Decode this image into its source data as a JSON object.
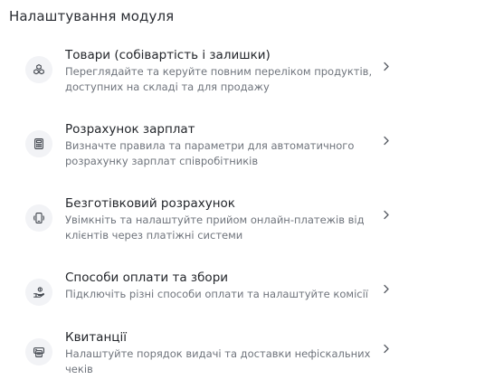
{
  "page": {
    "title": "Налаштування модуля"
  },
  "items": [
    {
      "title": "Товари (собівартість і залишки)",
      "description": "Переглядайте та керуйте повним переліком продуктів, доступних на складі та для продажу",
      "icon": "products-icon"
    },
    {
      "title": "Розрахунок зарплат",
      "description": "Визначте правила та параметри для автоматичного розрахунку зарплат співробітників",
      "icon": "payroll-calculator-icon"
    },
    {
      "title": "Безготівковий розрахунок",
      "description": "Увімкніть та налаштуйте прийом онлайн-платежів від клієнтів через платіжні системи",
      "icon": "cashless-payment-icon"
    },
    {
      "title": "Способи оплати та збори",
      "description": "Підключіть різні способи оплати та налаштуйте комісії",
      "icon": "payment-methods-icon"
    },
    {
      "title": "Квитанції",
      "description": "Налаштуйте порядок видачі та доставки нефіскальних чеків",
      "icon": "receipt-printer-icon"
    }
  ],
  "colors": {
    "title": "#2a2d33",
    "item_title": "#23262b",
    "description": "#6f747c",
    "icon_bg": "#f2f3f6",
    "icon_stroke": "#3a3f47",
    "chevron": "#555a62"
  }
}
